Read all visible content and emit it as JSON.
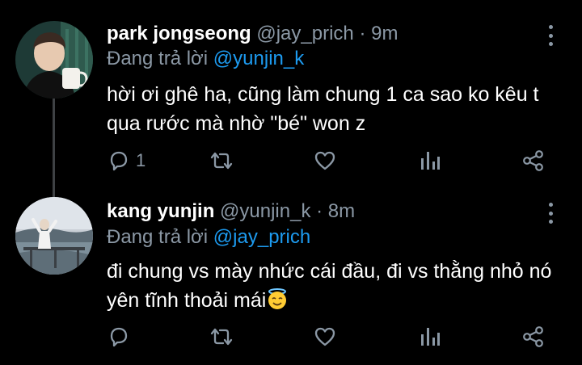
{
  "tweets": [
    {
      "author_name": "park jongseong",
      "handle": "@jay_prich",
      "separator": "·",
      "time": "9m",
      "reply_prefix": "Đang trả lời",
      "reply_mention": "@yunjin_k",
      "text": "hời ơi ghê ha, cũng làm chung 1 ca sao ko kêu t qua rước mà nhờ \"bé\" won z",
      "actions": {
        "reply_count": "1",
        "retweet_count": "",
        "like_count": ""
      },
      "icons": [
        "reply-icon",
        "retweet-icon",
        "like-icon",
        "analytics-icon",
        "share-icon"
      ]
    },
    {
      "author_name": "kang yunjin",
      "handle": "@yunjin_k",
      "separator": "·",
      "time": "8m",
      "reply_prefix": "Đang trả lời",
      "reply_mention": "@jay_prich",
      "text": "đi chung vs mày nhức cái đầu, đi vs thằng nhỏ nó yên tĩnh thoải mái",
      "emoji": "smiling-face-with-halo",
      "actions": {
        "reply_count": "",
        "retweet_count": "",
        "like_count": ""
      },
      "icons": [
        "reply-icon",
        "retweet-icon",
        "like-icon",
        "analytics-icon",
        "share-icon"
      ]
    }
  ],
  "colors": {
    "background": "#000000",
    "text": "#ffffff",
    "secondary": "#8b98a5",
    "accent": "#1d9bf0",
    "thread_line": "#3e4144"
  }
}
